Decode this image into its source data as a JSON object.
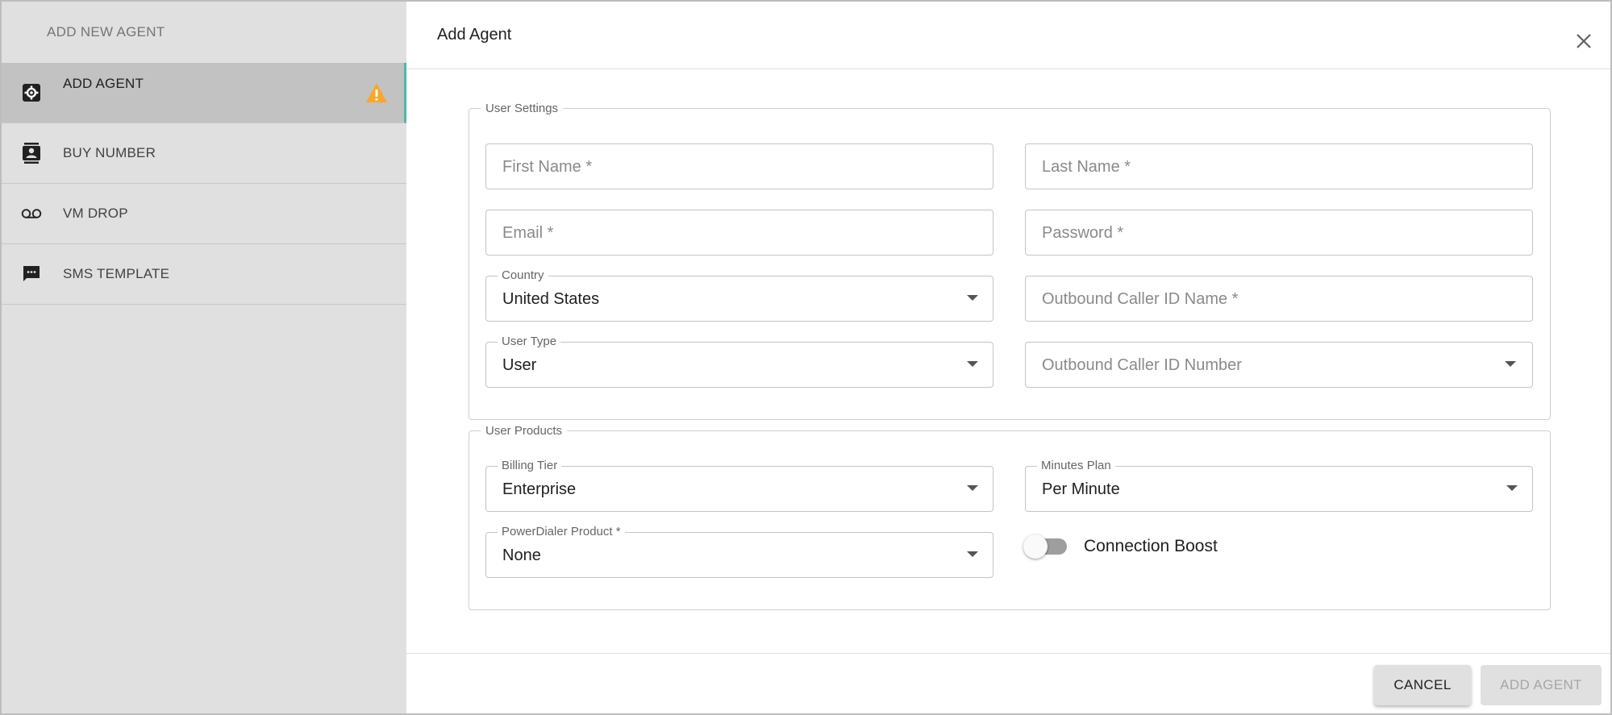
{
  "sidebar": {
    "title": "ADD NEW AGENT",
    "items": [
      {
        "label": "ADD AGENT",
        "icon": "settings-box-icon",
        "active": true,
        "warning": true
      },
      {
        "label": "BUY NUMBER",
        "icon": "contact-card-icon"
      },
      {
        "label": "VM DROP",
        "icon": "voicemail-icon"
      },
      {
        "label": "SMS TEMPLATE",
        "icon": "chat-bubble-icon"
      }
    ]
  },
  "dialog": {
    "title": "Add Agent",
    "user_settings": {
      "legend": "User Settings",
      "first_name": {
        "placeholder": "First Name *"
      },
      "last_name": {
        "placeholder": "Last Name *"
      },
      "email": {
        "placeholder": "Email *"
      },
      "password": {
        "placeholder": "Password *"
      },
      "country": {
        "label": "Country",
        "value": "United States"
      },
      "caller_id_name": {
        "placeholder": "Outbound Caller ID Name *"
      },
      "user_type": {
        "label": "User Type",
        "value": "User"
      },
      "caller_id_number": {
        "placeholder": "Outbound Caller ID Number"
      }
    },
    "user_products": {
      "legend": "User Products",
      "billing_tier": {
        "label": "Billing Tier",
        "value": "Enterprise"
      },
      "minutes_plan": {
        "label": "Minutes Plan",
        "value": "Per Minute"
      },
      "powerdialer": {
        "label": "PowerDialer Product *",
        "value": "None"
      },
      "connection_boost": {
        "label": "Connection Boost",
        "enabled": false
      }
    },
    "footer": {
      "cancel_label": "CANCEL",
      "add_label": "ADD AGENT"
    }
  },
  "colors": {
    "sidebar_bg": "#e0e0e0",
    "active_item_bg": "#c2c2c2",
    "active_accent": "#4db6ac",
    "warning": "#f9a825"
  }
}
